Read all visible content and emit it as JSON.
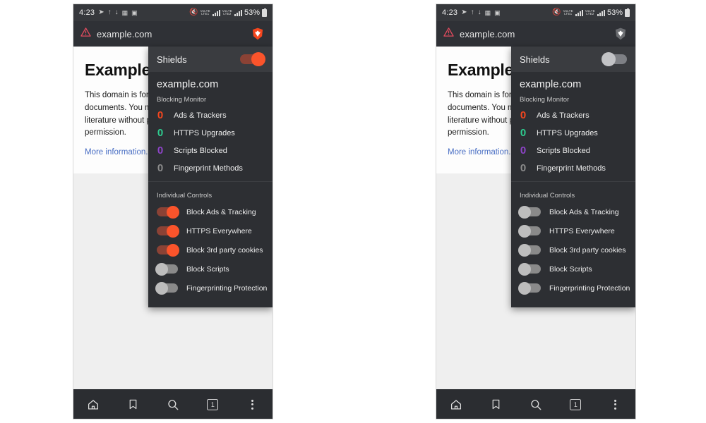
{
  "status_bar": {
    "time": "4:23",
    "battery": "53%",
    "left_icons": [
      "send-icon",
      "upload-icon",
      "download-icon",
      "image-icon",
      "screenshot-icon"
    ],
    "right_icons": [
      "mute-icon",
      "volte-signal-icon",
      "lte-signal-icon",
      "signal-icon",
      "battery-icon"
    ]
  },
  "browser": {
    "url": "example.com",
    "security_icon": "warning-triangle-icon",
    "brave_icon": "brave-lion-shield-icon"
  },
  "page": {
    "title": "Example Domain",
    "body_lines": [
      "This domain is for use in illustrative",
      "documents. You may use this domain in",
      "literature without prior coordination or asking for",
      "permission."
    ],
    "link": "More information..."
  },
  "bottom_nav": {
    "items": [
      {
        "name": "home-icon",
        "label": "Home"
      },
      {
        "name": "bookmark-icon",
        "label": "Bookmarks"
      },
      {
        "name": "search-icon",
        "label": "Search"
      },
      {
        "name": "tab-switcher-icon",
        "label": "Tabs"
      },
      {
        "name": "overflow-menu-icon",
        "label": "Menu"
      }
    ],
    "tab_count": "1"
  },
  "shields_panel": {
    "header_title": "Shields",
    "domain": "example.com",
    "blocking_monitor_label": "Blocking Monitor",
    "individual_controls_label": "Individual Controls",
    "stats": [
      {
        "count": "0",
        "label": "Ads & Trackers",
        "color": "#f5461e"
      },
      {
        "count": "0",
        "label": "HTTPS Upgrades",
        "color": "#2ecc8f"
      },
      {
        "count": "0",
        "label": "Scripts Blocked",
        "color": "#8e44c9"
      },
      {
        "count": "0",
        "label": "Fingerprint Methods",
        "color": "#8c8c8c"
      }
    ],
    "controls": [
      "Block Ads & Tracking",
      "HTTPS Everywhere",
      "Block 3rd party cookies",
      "Block Scripts",
      "Fingerprinting Protection"
    ]
  },
  "left_phone": {
    "shields_enabled": true,
    "shields_master_state": "on",
    "control_states": [
      "on",
      "on",
      "on",
      "off",
      "off"
    ]
  },
  "right_phone": {
    "shields_enabled": false,
    "shields_master_state": "off",
    "control_states": [
      "off",
      "off",
      "off",
      "off",
      "off"
    ]
  },
  "colors": {
    "accent_on": "#fb542b",
    "panel_bg": "#2d2f33",
    "panel_header_bg": "#3a3c40",
    "chrome_bg": "#2b2d31",
    "link": "#4a6fc4"
  }
}
